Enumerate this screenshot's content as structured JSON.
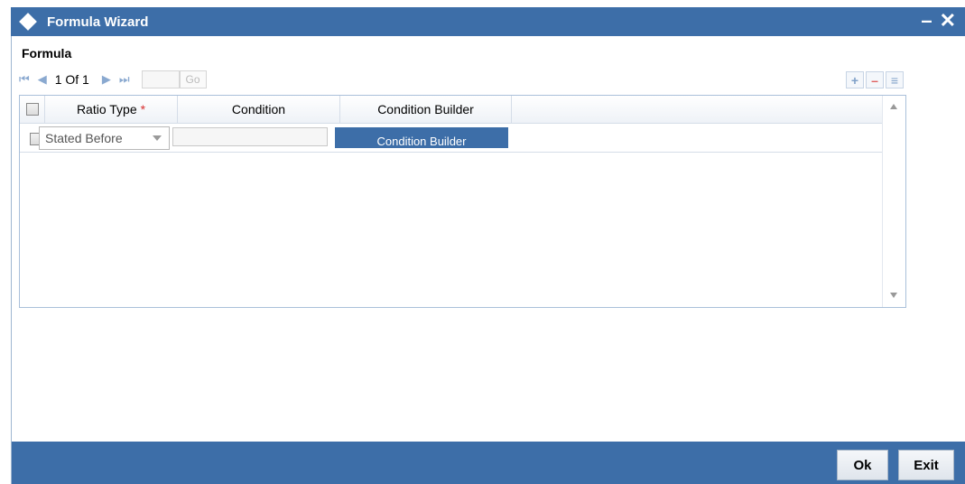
{
  "window": {
    "title": "Formula Wizard",
    "minimize": "–",
    "close": "✕"
  },
  "section": {
    "title": "Formula"
  },
  "pager": {
    "first": "⏮",
    "prev": "◀",
    "page_info": "1 Of 1",
    "next": "▶",
    "last": "⏭",
    "go_label": "Go"
  },
  "grid_tools": {
    "add": "+",
    "remove": "–",
    "single_view": "≡"
  },
  "grid": {
    "columns": [
      {
        "label": "Ratio Type",
        "required": "*"
      },
      {
        "label": "Condition"
      },
      {
        "label": "Condition Builder"
      }
    ],
    "rows": [
      {
        "ratio_type": "Stated Before",
        "condition": "",
        "builder_button": "Condition Builder"
      }
    ]
  },
  "footer": {
    "ok_label": "Ok",
    "exit_label": "Exit"
  },
  "colors": {
    "accent": "#3d6ea8",
    "required": "#d83030"
  }
}
